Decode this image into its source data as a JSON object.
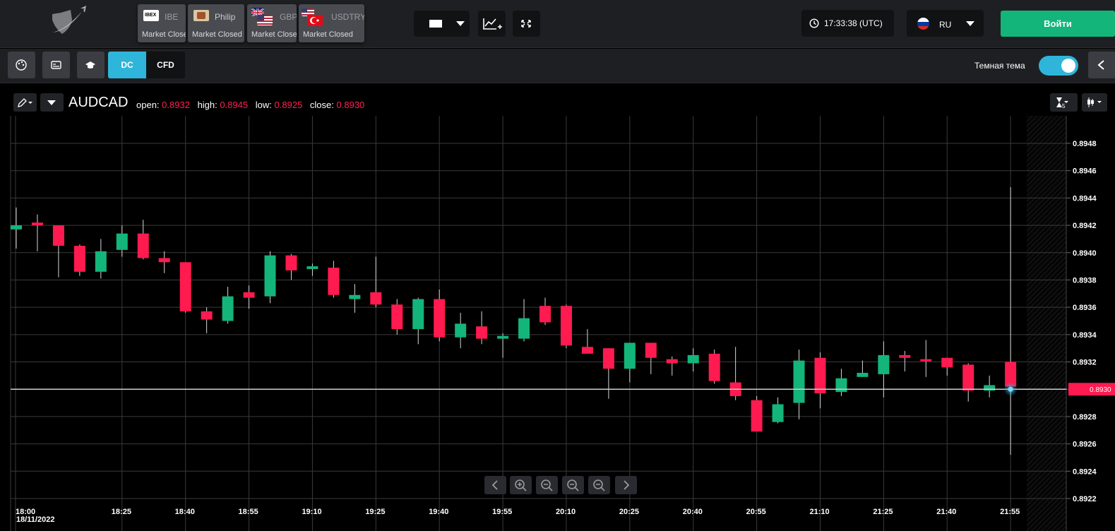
{
  "topbar": {
    "assets": [
      {
        "name": "IBE",
        "status": "Market Closed",
        "flag": "ibex"
      },
      {
        "name": "Philip",
        "status": "Market Closed",
        "flag": "philip"
      },
      {
        "name": "GBP",
        "status": "Market Closed",
        "flag": "uk-us"
      },
      {
        "name": "USDTRY",
        "status": "Market Closed",
        "flag": "us-tr"
      }
    ],
    "clock": "17:33:38 (UTC)",
    "language": "RU",
    "login_label": "Войти"
  },
  "toolbar": {
    "mode_dc": "DC",
    "mode_cfd": "CFD",
    "active_mode": "DC",
    "theme_label": "Темная тема",
    "dark_theme_on": true
  },
  "chart": {
    "symbol": "AUDCAD",
    "open_label": "open:",
    "open": "0.8932",
    "high_label": "high:",
    "high": "0.8945",
    "low_label": "low:",
    "low": "0.8925",
    "close_label": "close:",
    "close": "0.8930",
    "current_price_tag": "0.8930",
    "date_label": "18/11/2022",
    "timeframe_subscript": "5"
  },
  "colors": {
    "up": "#13b57a",
    "down": "#ff1a4f",
    "accent": "#2fb5d9",
    "login": "#13b57a"
  },
  "chart_data": {
    "type": "candlestick",
    "symbol": "AUDCAD",
    "ylim": [
      0.8922,
      0.8949
    ],
    "y_ticks": [
      "0.8922",
      "0.8924",
      "0.8926",
      "0.8928",
      "0.8930",
      "0.8932",
      "0.8934",
      "0.8936",
      "0.8938",
      "0.8940",
      "0.8942",
      "0.8944",
      "0.8946",
      "0.8948"
    ],
    "x_ticks": [
      "18:00",
      "18:25",
      "18:40",
      "18:55",
      "19:10",
      "19:25",
      "19:40",
      "19:55",
      "20:10",
      "20:25",
      "20:40",
      "20:55",
      "21:10",
      "21:25",
      "21:40",
      "21:55"
    ],
    "candles": [
      {
        "o": 0.89417,
        "h": 0.89433,
        "l": 0.89403,
        "c": 0.8942
      },
      {
        "o": 0.89422,
        "h": 0.89428,
        "l": 0.89401,
        "c": 0.8942
      },
      {
        "o": 0.8942,
        "h": 0.89419,
        "l": 0.89382,
        "c": 0.89405
      },
      {
        "o": 0.89405,
        "h": 0.89406,
        "l": 0.89383,
        "c": 0.89386
      },
      {
        "o": 0.89386,
        "h": 0.8941,
        "l": 0.89381,
        "c": 0.89401
      },
      {
        "o": 0.89402,
        "h": 0.8942,
        "l": 0.89397,
        "c": 0.89414
      },
      {
        "o": 0.89414,
        "h": 0.89424,
        "l": 0.89395,
        "c": 0.89396
      },
      {
        "o": 0.89396,
        "h": 0.89401,
        "l": 0.89385,
        "c": 0.89393
      },
      {
        "o": 0.89393,
        "h": 0.89392,
        "l": 0.89356,
        "c": 0.89357
      },
      {
        "o": 0.89357,
        "h": 0.8936,
        "l": 0.89341,
        "c": 0.89351
      },
      {
        "o": 0.8935,
        "h": 0.89375,
        "l": 0.89348,
        "c": 0.89368
      },
      {
        "o": 0.89371,
        "h": 0.89376,
        "l": 0.89359,
        "c": 0.89367
      },
      {
        "o": 0.89368,
        "h": 0.89401,
        "l": 0.89363,
        "c": 0.89398
      },
      {
        "o": 0.89398,
        "h": 0.89399,
        "l": 0.8938,
        "c": 0.89387
      },
      {
        "o": 0.89388,
        "h": 0.89392,
        "l": 0.89383,
        "c": 0.8939
      },
      {
        "o": 0.89389,
        "h": 0.89394,
        "l": 0.89367,
        "c": 0.89369
      },
      {
        "o": 0.89366,
        "h": 0.89377,
        "l": 0.89356,
        "c": 0.89369
      },
      {
        "o": 0.89371,
        "h": 0.89397,
        "l": 0.8936,
        "c": 0.89362
      },
      {
        "o": 0.89362,
        "h": 0.89366,
        "l": 0.8934,
        "c": 0.89344
      },
      {
        "o": 0.89344,
        "h": 0.89367,
        "l": 0.89333,
        "c": 0.89366
      },
      {
        "o": 0.89366,
        "h": 0.89373,
        "l": 0.89335,
        "c": 0.89338
      },
      {
        "o": 0.89338,
        "h": 0.89356,
        "l": 0.8933,
        "c": 0.89348
      },
      {
        "o": 0.89346,
        "h": 0.89357,
        "l": 0.89333,
        "c": 0.89337
      },
      {
        "o": 0.89337,
        "h": 0.89341,
        "l": 0.89323,
        "c": 0.89339
      },
      {
        "o": 0.89337,
        "h": 0.89366,
        "l": 0.89335,
        "c": 0.89352
      },
      {
        "o": 0.89361,
        "h": 0.89367,
        "l": 0.89347,
        "c": 0.89349
      },
      {
        "o": 0.89361,
        "h": 0.89362,
        "l": 0.8933,
        "c": 0.89332
      },
      {
        "o": 0.89331,
        "h": 0.89344,
        "l": 0.89327,
        "c": 0.89326
      },
      {
        "o": 0.8933,
        "h": 0.89329,
        "l": 0.89293,
        "c": 0.89315
      },
      {
        "o": 0.89315,
        "h": 0.89334,
        "l": 0.89305,
        "c": 0.89334
      },
      {
        "o": 0.89334,
        "h": 0.89334,
        "l": 0.89311,
        "c": 0.89323
      },
      {
        "o": 0.89322,
        "h": 0.89324,
        "l": 0.8931,
        "c": 0.89319
      },
      {
        "o": 0.89319,
        "h": 0.8933,
        "l": 0.89313,
        "c": 0.89325
      },
      {
        "o": 0.89326,
        "h": 0.89329,
        "l": 0.89304,
        "c": 0.89306
      },
      {
        "o": 0.89305,
        "h": 0.89331,
        "l": 0.89292,
        "c": 0.89295
      },
      {
        "o": 0.89292,
        "h": 0.89295,
        "l": 0.8927,
        "c": 0.89269
      },
      {
        "o": 0.89276,
        "h": 0.89294,
        "l": 0.89275,
        "c": 0.89289
      },
      {
        "o": 0.8929,
        "h": 0.89329,
        "l": 0.89278,
        "c": 0.89321
      },
      {
        "o": 0.89323,
        "h": 0.89327,
        "l": 0.89286,
        "c": 0.89297
      },
      {
        "o": 0.89298,
        "h": 0.89315,
        "l": 0.89295,
        "c": 0.89308
      },
      {
        "o": 0.89309,
        "h": 0.89321,
        "l": 0.89309,
        "c": 0.89312
      },
      {
        "o": 0.89311,
        "h": 0.89335,
        "l": 0.89294,
        "c": 0.89325
      },
      {
        "o": 0.89325,
        "h": 0.89328,
        "l": 0.89313,
        "c": 0.89323
      },
      {
        "o": 0.89322,
        "h": 0.89336,
        "l": 0.89309,
        "c": 0.89321
      },
      {
        "o": 0.89323,
        "h": 0.89321,
        "l": 0.8931,
        "c": 0.89316
      },
      {
        "o": 0.89318,
        "h": 0.89319,
        "l": 0.89291,
        "c": 0.89299
      },
      {
        "o": 0.89299,
        "h": 0.8931,
        "l": 0.89294,
        "c": 0.89303
      },
      {
        "o": 0.8932,
        "h": 0.89448,
        "l": 0.89252,
        "c": 0.89302
      }
    ],
    "grid": true,
    "current_price": 0.893
  },
  "nav": {
    "prev": "chevron-left-icon",
    "zoom_in": "zoom-in-icon",
    "zoom_out_1": "zoom-out-icon",
    "zoom_out_2": "zoom-out-icon",
    "zoom_out_3": "zoom-out-icon",
    "next": "chevron-right-icon"
  }
}
